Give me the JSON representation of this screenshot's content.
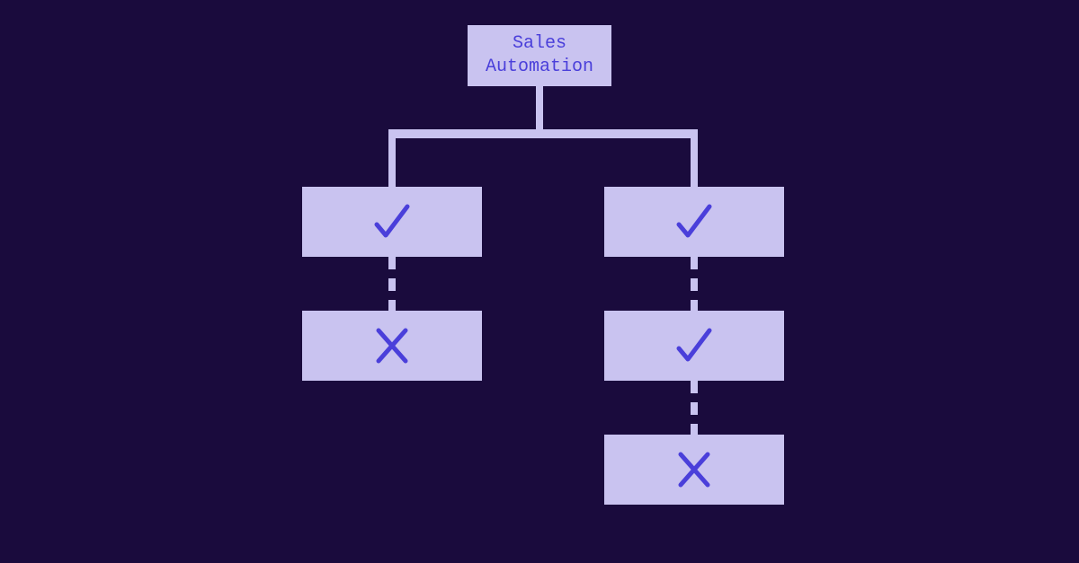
{
  "root": {
    "label": "Sales\nAutomation"
  },
  "left": {
    "node1": "check",
    "node2": "x"
  },
  "right": {
    "node1": "check",
    "node2": "check",
    "node3": "x"
  },
  "icons": {
    "check": "check",
    "x": "x"
  }
}
